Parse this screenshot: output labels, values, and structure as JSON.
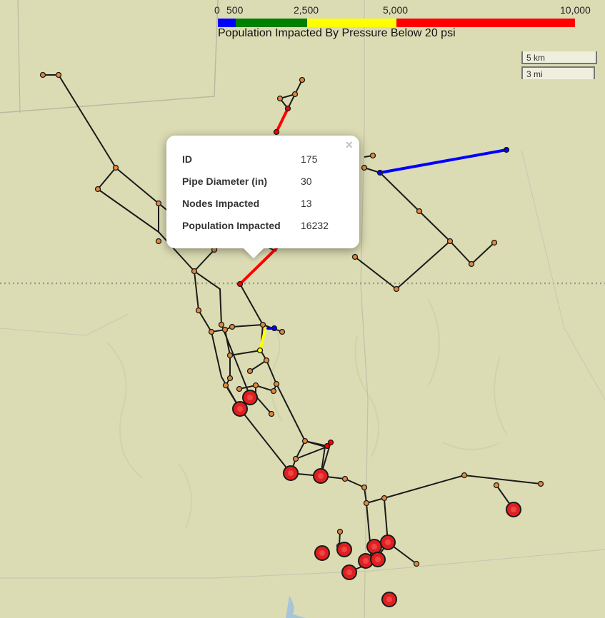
{
  "legend": {
    "ticks": [
      "0",
      "500",
      "2,500",
      "5,000",
      "10,000"
    ],
    "title": "Population Impacted By Pressure Below 20 psi",
    "colors": {
      "blue": "#0000ff",
      "green": "#008000",
      "yellow": "#ffff00",
      "red": "#ff0000"
    }
  },
  "scale": {
    "km_label": "5 km",
    "mi_label": "3 mi"
  },
  "popup": {
    "close_icon": "×",
    "rows": [
      {
        "key": "ID",
        "value": "175"
      },
      {
        "key": "Pipe Diameter (in)",
        "value": "30"
      },
      {
        "key": "Nodes Impacted",
        "value": "13"
      },
      {
        "key": "Population Impacted",
        "value": "16232"
      }
    ]
  },
  "map_style": {
    "land": "#dcdcb4",
    "pipe": "#1a1a1a",
    "node_fill": "#e08a3c",
    "impact_fill": "#e02020"
  }
}
